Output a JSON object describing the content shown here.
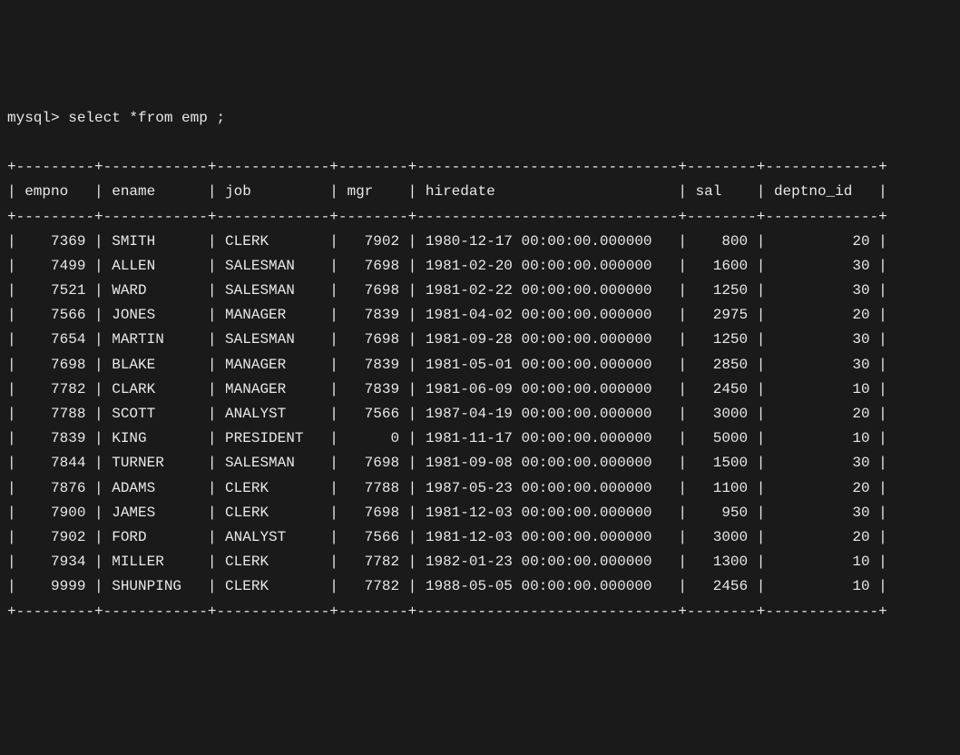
{
  "prompt_text": "mysql> select *from emp ;",
  "columns": [
    {
      "name": "empno",
      "width": 7,
      "align": "right"
    },
    {
      "name": "ename",
      "width": 10,
      "align": "left"
    },
    {
      "name": "job",
      "width": 11,
      "align": "left"
    },
    {
      "name": "mgr",
      "width": 6,
      "align": "right"
    },
    {
      "name": "hiredate",
      "width": 28,
      "align": "left"
    },
    {
      "name": "sal",
      "width": 6,
      "align": "right"
    },
    {
      "name": "deptno_id",
      "width": 11,
      "align": "right"
    }
  ],
  "rows": [
    {
      "empno": "7369",
      "ename": "SMITH",
      "job": "CLERK",
      "mgr": "7902",
      "hiredate": "1980-12-17 00:00:00.000000",
      "sal": "800",
      "deptno_id": "20"
    },
    {
      "empno": "7499",
      "ename": "ALLEN",
      "job": "SALESMAN",
      "mgr": "7698",
      "hiredate": "1981-02-20 00:00:00.000000",
      "sal": "1600",
      "deptno_id": "30"
    },
    {
      "empno": "7521",
      "ename": "WARD",
      "job": "SALESMAN",
      "mgr": "7698",
      "hiredate": "1981-02-22 00:00:00.000000",
      "sal": "1250",
      "deptno_id": "30"
    },
    {
      "empno": "7566",
      "ename": "JONES",
      "job": "MANAGER",
      "mgr": "7839",
      "hiredate": "1981-04-02 00:00:00.000000",
      "sal": "2975",
      "deptno_id": "20"
    },
    {
      "empno": "7654",
      "ename": "MARTIN",
      "job": "SALESMAN",
      "mgr": "7698",
      "hiredate": "1981-09-28 00:00:00.000000",
      "sal": "1250",
      "deptno_id": "30"
    },
    {
      "empno": "7698",
      "ename": "BLAKE",
      "job": "MANAGER",
      "mgr": "7839",
      "hiredate": "1981-05-01 00:00:00.000000",
      "sal": "2850",
      "deptno_id": "30"
    },
    {
      "empno": "7782",
      "ename": "CLARK",
      "job": "MANAGER",
      "mgr": "7839",
      "hiredate": "1981-06-09 00:00:00.000000",
      "sal": "2450",
      "deptno_id": "10"
    },
    {
      "empno": "7788",
      "ename": "SCOTT",
      "job": "ANALYST",
      "mgr": "7566",
      "hiredate": "1987-04-19 00:00:00.000000",
      "sal": "3000",
      "deptno_id": "20"
    },
    {
      "empno": "7839",
      "ename": "KING",
      "job": "PRESIDENT",
      "mgr": "0",
      "hiredate": "1981-11-17 00:00:00.000000",
      "sal": "5000",
      "deptno_id": "10"
    },
    {
      "empno": "7844",
      "ename": "TURNER",
      "job": "SALESMAN",
      "mgr": "7698",
      "hiredate": "1981-09-08 00:00:00.000000",
      "sal": "1500",
      "deptno_id": "30"
    },
    {
      "empno": "7876",
      "ename": "ADAMS",
      "job": "CLERK",
      "mgr": "7788",
      "hiredate": "1987-05-23 00:00:00.000000",
      "sal": "1100",
      "deptno_id": "20"
    },
    {
      "empno": "7900",
      "ename": "JAMES",
      "job": "CLERK",
      "mgr": "7698",
      "hiredate": "1981-12-03 00:00:00.000000",
      "sal": "950",
      "deptno_id": "30"
    },
    {
      "empno": "7902",
      "ename": "FORD",
      "job": "ANALYST",
      "mgr": "7566",
      "hiredate": "1981-12-03 00:00:00.000000",
      "sal": "3000",
      "deptno_id": "20"
    },
    {
      "empno": "7934",
      "ename": "MILLER",
      "job": "CLERK",
      "mgr": "7782",
      "hiredate": "1982-01-23 00:00:00.000000",
      "sal": "1300",
      "deptno_id": "10"
    },
    {
      "empno": "9999",
      "ename": "SHUNPING",
      "job": "CLERK",
      "mgr": "7782",
      "hiredate": "1988-05-05 00:00:00.000000",
      "sal": "2456",
      "deptno_id": "10"
    }
  ]
}
